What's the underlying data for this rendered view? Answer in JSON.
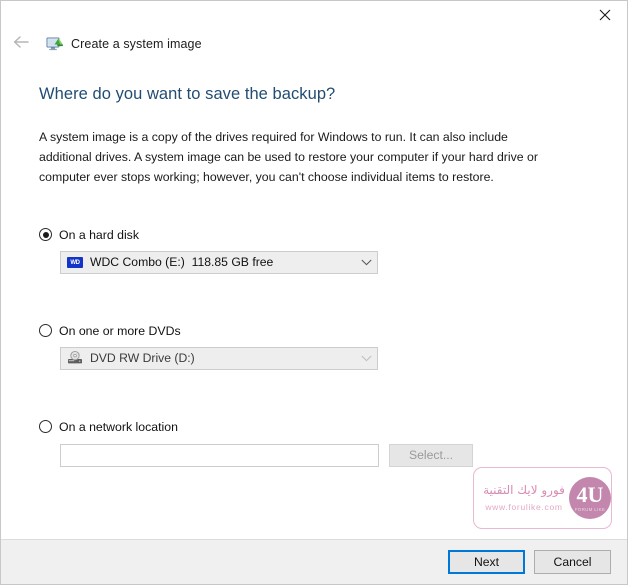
{
  "window": {
    "app_title": "Create a system image",
    "app_icon": "system-image-icon",
    "close_icon": "close-icon",
    "back_icon": "back-arrow-icon"
  },
  "page": {
    "heading": "Where do you want to save the backup?",
    "description": "A system image is a copy of the drives required for Windows to run. It can also include additional drives. A system image can be used to restore your computer if your hard drive or computer ever stops working; however, you can't choose individual items to restore.",
    "heading_color": "#234c72"
  },
  "options": {
    "hard_disk": {
      "label": "On a hard disk",
      "selected": true,
      "combo_value": "WDC Combo (E:)  118.85 GB free",
      "combo_icon": "hard-drive-icon",
      "chevron_icon": "chevron-down-icon",
      "enabled": true
    },
    "dvd": {
      "label": "On one or more DVDs",
      "selected": false,
      "combo_value": "DVD RW Drive (D:)",
      "combo_icon": "optical-drive-icon",
      "chevron_icon": "chevron-down-icon",
      "enabled": false
    },
    "network": {
      "label": "On a network location",
      "selected": false,
      "input_value": "",
      "input_placeholder": "",
      "select_button_label": "Select...",
      "enabled": false
    }
  },
  "watermark": {
    "arabic_text": "فورو لايك التقنية",
    "url": "www.forulike.com",
    "badge_text": "4U",
    "badge_sub": "FORUM  LIKE",
    "accent_color": "#d98bb4"
  },
  "footer": {
    "next_label": "Next",
    "cancel_label": "Cancel",
    "focus_color": "#0078d7"
  }
}
